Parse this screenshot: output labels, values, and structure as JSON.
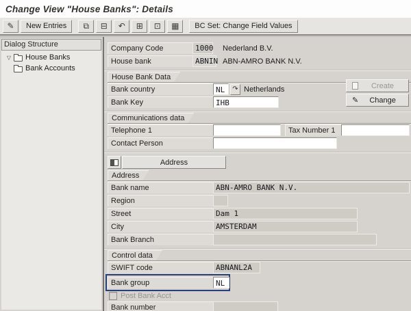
{
  "title": "Change View \"House Banks\": Details",
  "toolbar": {
    "new_entries": "New Entries",
    "bc_set": "BC Set: Change Field Values"
  },
  "icons": {
    "display_change": "✎",
    "copy": "⧉",
    "delete": "⊟",
    "undo": "↶",
    "select_all": "⊞",
    "select_block": "⊡",
    "deselect_all": "▦",
    "value_help": "↷",
    "expander": "▽",
    "change_pencil": "✎"
  },
  "sidebar": {
    "header": "Dialog Structure",
    "items": [
      {
        "label": "House Banks",
        "expanded": true
      },
      {
        "label": "Bank Accounts",
        "expanded": false
      }
    ]
  },
  "header_fields": {
    "company_code": {
      "label": "Company Code",
      "value": "1000",
      "description": "Nederland B.V."
    },
    "house_bank": {
      "label": "House bank",
      "value": "ABNIN",
      "description": "ABN-AMRO BANK N.V."
    }
  },
  "groups": {
    "house_bank_data": {
      "title": "House Bank Data",
      "bank_country": {
        "label": "Bank country",
        "value": "NL",
        "description": "Netherlands"
      },
      "bank_key": {
        "label": "Bank Key",
        "value": "IHB"
      }
    },
    "communications": {
      "title": "Communications data",
      "telephone": {
        "label": "Telephone 1",
        "value": ""
      },
      "tax_number": {
        "label": "Tax Number 1",
        "value": ""
      },
      "contact_person": {
        "label": "Contact Person",
        "value": ""
      }
    },
    "address": {
      "title": "Address",
      "button_label": "Address",
      "bank_name": {
        "label": "Bank name",
        "value": "ABN-AMRO BANK N.V."
      },
      "region": {
        "label": "Region",
        "value": ""
      },
      "street": {
        "label": "Street",
        "value": "Dam 1"
      },
      "city": {
        "label": "City",
        "value": "AMSTERDAM"
      },
      "bank_branch": {
        "label": "Bank Branch",
        "value": ""
      }
    },
    "control": {
      "title": "Control data",
      "swift": {
        "label": "SWIFT code",
        "value": "ABNANL2A"
      },
      "bank_group": {
        "label": "Bank group",
        "value": "NL"
      },
      "post_bank_acct": {
        "label": "Post Bank Acct",
        "checked": false
      },
      "bank_number": {
        "label": "Bank number",
        "value": ""
      }
    }
  },
  "buttons": {
    "create": "Create",
    "change": "Change"
  },
  "annotation": {
    "highlighted_field": "Bank group",
    "color": "#25407d"
  }
}
